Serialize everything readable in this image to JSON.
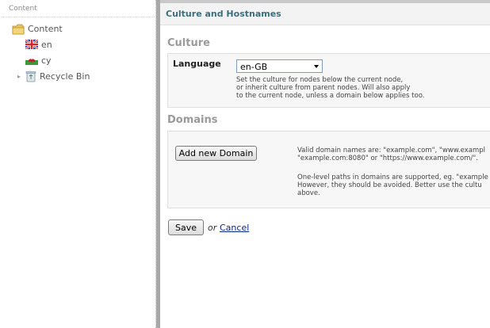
{
  "tree": {
    "header": "Content",
    "nodes": [
      {
        "label": "Content",
        "icon": "folder-icon"
      },
      {
        "label": "en",
        "icon": "uk-flag-icon"
      },
      {
        "label": "cy",
        "icon": "welsh-flag-icon"
      },
      {
        "label": "Recycle Bin",
        "icon": "recycle-bin-icon"
      }
    ]
  },
  "page": {
    "title": "Culture and Hostnames"
  },
  "culture": {
    "section_title": "Culture",
    "language_label": "Language",
    "language_value": "en-GB",
    "help_lines": [
      "Set the culture for nodes below the current node,",
      "or inherit culture from parent nodes. Will also apply",
      "to the current node, unless a domain below applies too."
    ]
  },
  "domains": {
    "section_title": "Domains",
    "add_button_label": "Add new Domain",
    "help_lines_1": [
      "Valid domain names are: \"example.com\", \"www.exampl",
      "\"example.com:8080\" or \"https://www.example.com/\"."
    ],
    "help_lines_2": [
      "One-level paths in domains are supported, eg. \"example",
      "However, they should be avoided. Better use the cultu",
      "above."
    ]
  },
  "actions": {
    "save_label": "Save",
    "or_text": "or",
    "cancel_label": "Cancel"
  },
  "colors": {
    "title_accent": "#3a6f7d",
    "section_title": "#9a9a9a",
    "link": "#0a2a8a"
  }
}
